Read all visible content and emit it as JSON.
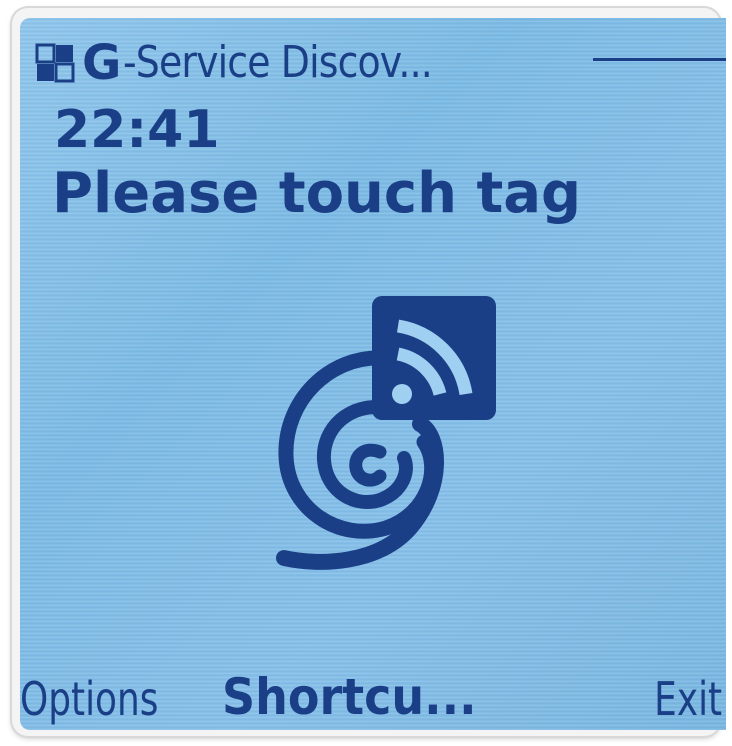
{
  "title_bar": {
    "network_icon": "network-status-icon",
    "network_letter": "G",
    "app_title": "-Service Discov..."
  },
  "status": {
    "time": "22:41",
    "message": "Please touch tag"
  },
  "logo": {
    "icon": "nfc-touch-icon"
  },
  "softkeys": {
    "left": "Options",
    "middle": "Shortcu...",
    "right": "Exit"
  },
  "colors": {
    "text": "#1a3f86",
    "screen_background": "#86c0ea"
  }
}
